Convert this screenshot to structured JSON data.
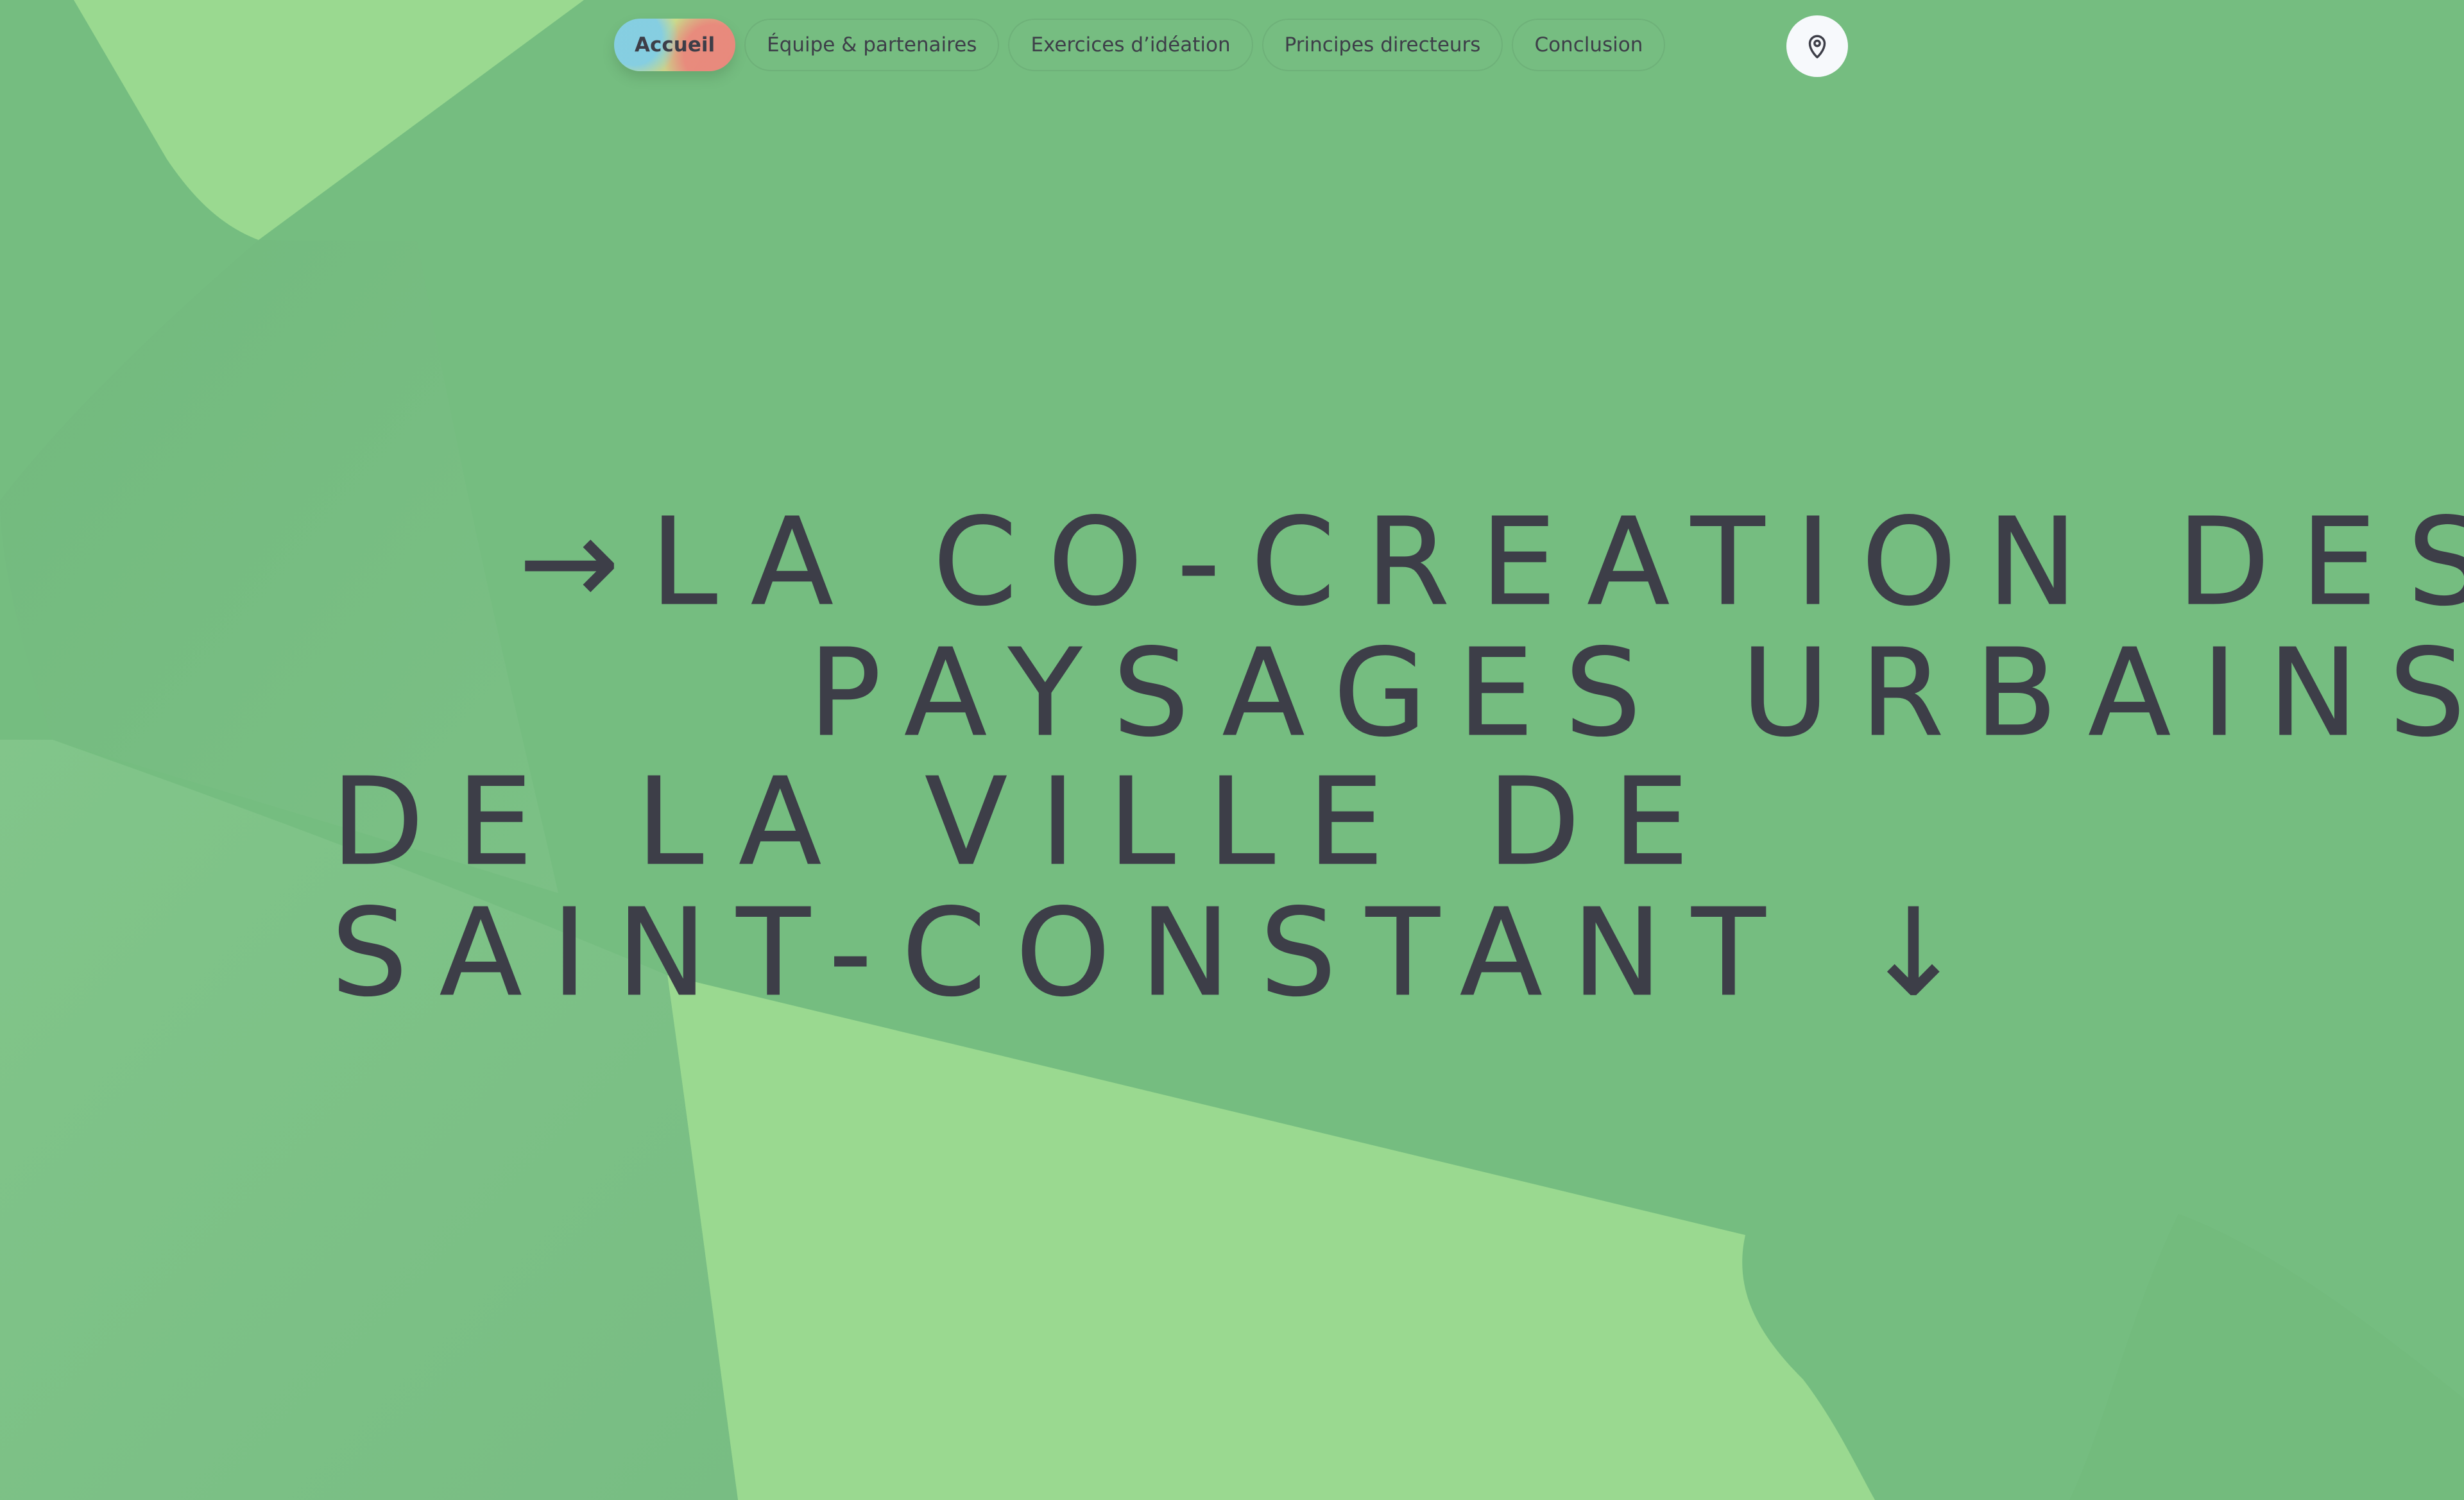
{
  "nav": {
    "items": [
      {
        "label": "Accueil",
        "active": true
      },
      {
        "label": "Équipe & partenaires",
        "active": false
      },
      {
        "label": "Exercices d’idéation",
        "active": false
      },
      {
        "label": "Principes directeurs",
        "active": false
      },
      {
        "label": "Conclusion",
        "active": false
      }
    ]
  },
  "location": {
    "icon": "map-pin-icon"
  },
  "hero": {
    "lines": [
      "→LA CO-CREATION DES",
      "PAYSAGES URBAINS",
      "DE LA VILLE DE",
      "SAINT-CONSTANT ↓"
    ]
  },
  "colors": {
    "background": "#75bd80",
    "light_shape": "#9ad990",
    "text": "#3d3e48",
    "button": "#f7f9fc"
  }
}
